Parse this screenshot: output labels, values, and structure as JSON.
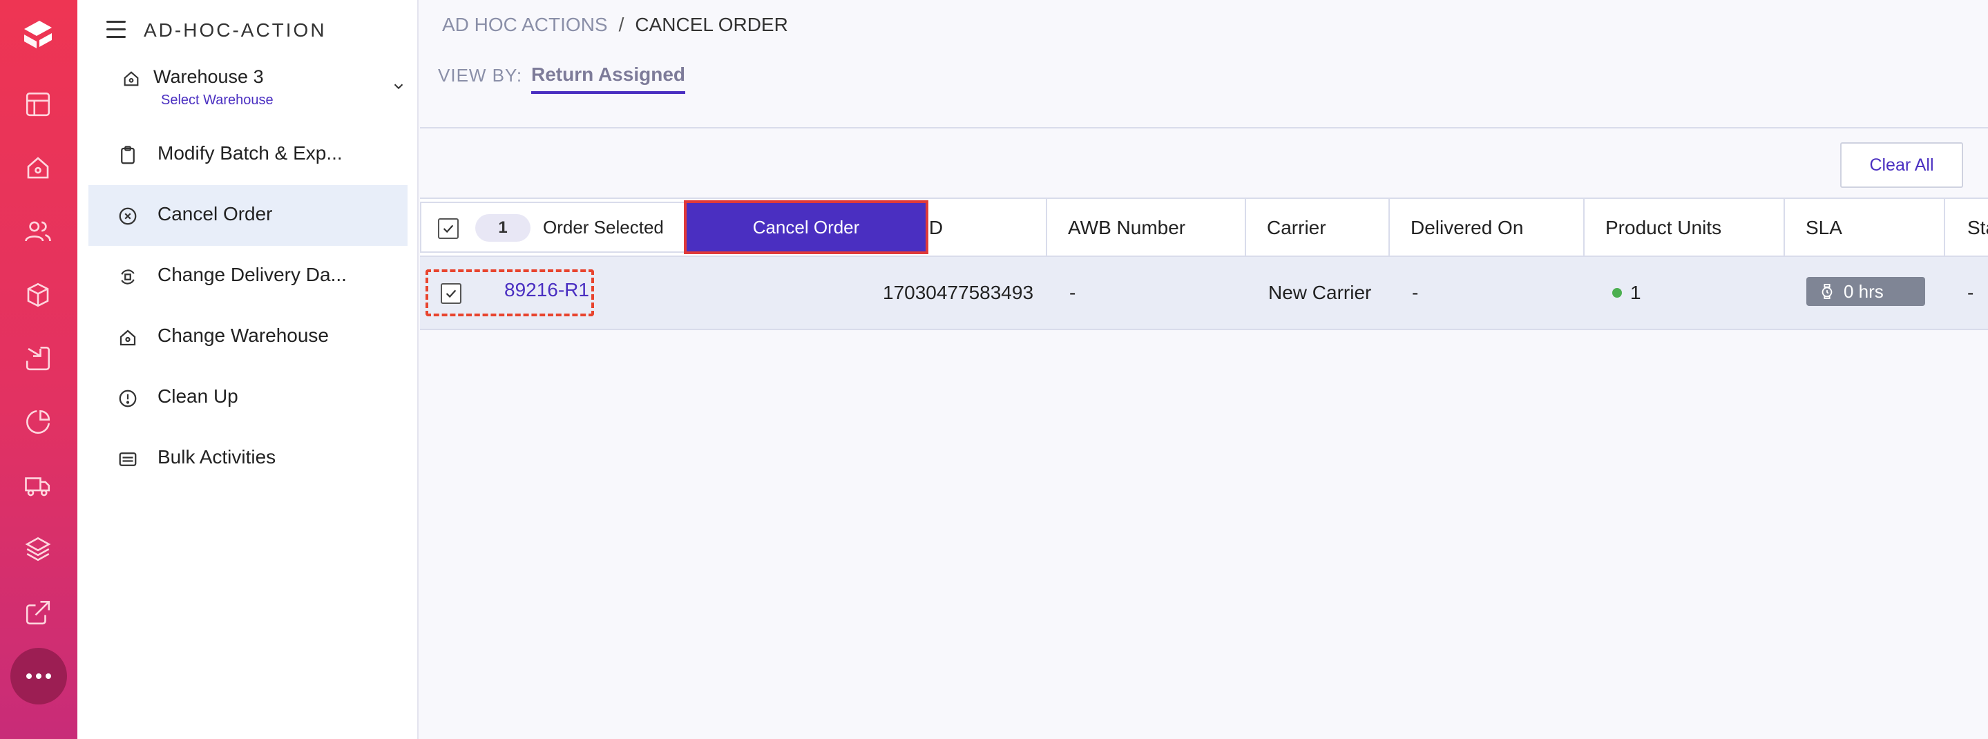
{
  "sidebar": {
    "app_title": "AD-HOC-ACTION",
    "warehouse": {
      "name": "Warehouse 3",
      "sub_label": "Select Warehouse"
    },
    "items": [
      {
        "label": "Modify Batch & Exp...",
        "icon": "clipboard-icon"
      },
      {
        "label": "Cancel Order",
        "icon": "cancel-circle-icon",
        "active": true
      },
      {
        "label": "Change Delivery Da...",
        "icon": "delivery-change-icon"
      },
      {
        "label": "Change Warehouse",
        "icon": "warehouse-icon"
      },
      {
        "label": "Clean Up",
        "icon": "alert-circle-icon"
      },
      {
        "label": "Bulk Activities",
        "icon": "list-card-icon"
      }
    ]
  },
  "rail_icons": [
    "layout-icon",
    "home-icon",
    "users-icon",
    "box-icon",
    "inbound-icon",
    "pie-chart-icon",
    "truck-icon",
    "layers-icon",
    "external-link-icon",
    "more-icon"
  ],
  "breadcrumb": {
    "parent": "AD HOC ACTIONS",
    "separator": "/",
    "current": "CANCEL ORDER"
  },
  "view_by": {
    "label": "VIEW BY:",
    "active_tab": "Return Assigned"
  },
  "toolbar": {
    "clear_all": "Clear All"
  },
  "bulk": {
    "count": "1",
    "selected_text": "Order Selected",
    "cancel_button": "Cancel Order"
  },
  "table": {
    "columns": [
      "ing ID",
      "AWB Number",
      "Carrier",
      "Delivered On",
      "Product Units",
      "SLA",
      "Sta"
    ],
    "rows": [
      {
        "order_id": "89216-R1",
        "tracking_id": "17030477583493",
        "awb": "-",
        "carrier": "New Carrier",
        "delivered_on": "-",
        "product_units": "1",
        "sla": "0 hrs",
        "status": "-"
      }
    ]
  },
  "colors": {
    "accent": "#4a2fc1",
    "rail_top": "#ee3553",
    "rail_bottom": "#c82c78",
    "highlight": "#e8442e"
  }
}
